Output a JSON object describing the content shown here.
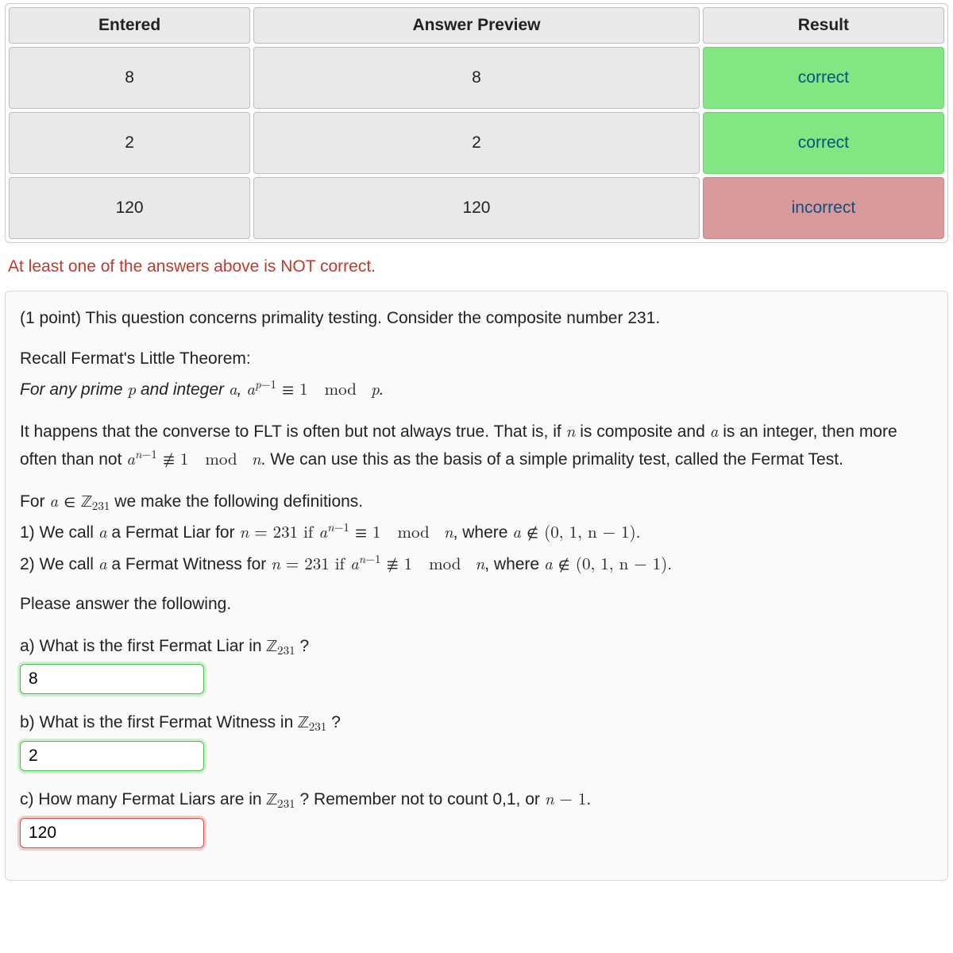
{
  "results_table": {
    "headers": [
      "Entered",
      "Answer Preview",
      "Result"
    ],
    "rows": [
      {
        "entered": "8",
        "preview": "8",
        "result": "correct",
        "status": "correct"
      },
      {
        "entered": "2",
        "preview": "2",
        "result": "correct",
        "status": "correct"
      },
      {
        "entered": "120",
        "preview": "120",
        "result": "incorrect",
        "status": "incorrect"
      }
    ]
  },
  "warning": "At least one of the answers above is NOT correct.",
  "problem": {
    "points_prefix": "(1 point) ",
    "intro": "This question concerns primality testing. Consider the composite number 231.",
    "flt_heading": "Recall Fermat's Little Theorem:",
    "flt_stmt_1": "For any prime ",
    "flt_stmt_2": " and integer ",
    "flt_stmt_3": ", ",
    "converse_1": "It happens that the converse to FLT is often but not always true. That is, if ",
    "converse_2": " is composite and ",
    "converse_3": " is an integer, then more often than not ",
    "converse_4": ". We can use this as the basis of a simple primality test, called the Fermat Test.",
    "defs_intro_1": "For ",
    "defs_intro_2": " we make the following definitions.",
    "def1_pre": "1) We call ",
    "def1_mid": " a Fermat Liar for ",
    "def1_n_eq": " = 231 if ",
    "def1_post": ", where ",
    "def2_pre": "2) We call ",
    "def2_mid": " a Fermat Witness for ",
    "def2_n_eq": " = 231 if ",
    "def2_post": ", where ",
    "please": "Please answer the following.",
    "qa_pre": "a) What is the first Fermat Liar in ",
    "qa_post": " ?",
    "qb_pre": "b) What is the first Fermat Witness in ",
    "qb_post": " ?",
    "qc_pre": "c) How many Fermat Liars are in ",
    "qc_post": " ? Remember not to count 0,1, or ",
    "qc_tail": "."
  },
  "answers": {
    "a": "8",
    "b": "2",
    "c": "120"
  },
  "math": {
    "n_minus_1": "n − 1",
    "set_excl": "(0, 1, n − 1)",
    "Z231": "231"
  }
}
